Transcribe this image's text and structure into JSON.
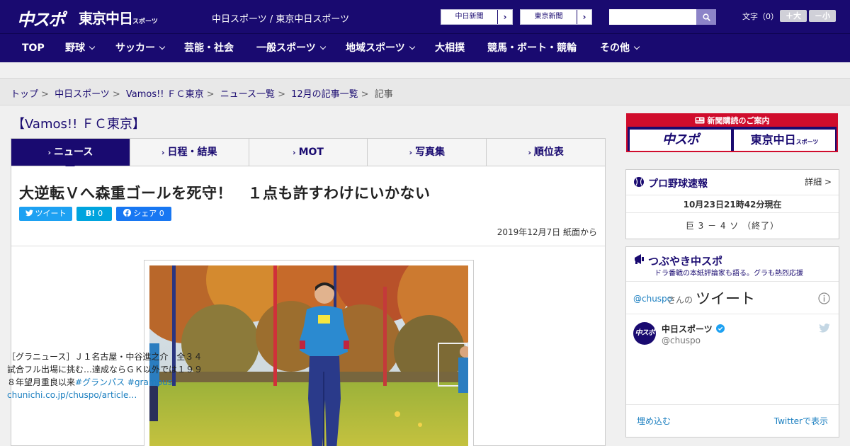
{
  "header": {
    "logo_chuspo": "中スポ",
    "logo_tokyo": "東京中日",
    "logo_tokyo_small": "スポーツ",
    "site_name": "中日スポーツ / 東京中日スポーツ",
    "paper_links": [
      {
        "label": "中日新聞",
        "arrow": "›"
      },
      {
        "label": "東京新聞",
        "arrow": "›"
      }
    ],
    "search_placeholder": "",
    "font_label": "文字（0）",
    "font_larger": "＋大",
    "font_smaller": "－小",
    "colors": {
      "navy": "#190a70",
      "red": "#d00c2c"
    }
  },
  "nav": {
    "items": [
      {
        "label": "TOP",
        "dropdown": false
      },
      {
        "label": "野球",
        "dropdown": true
      },
      {
        "label": "サッカー",
        "dropdown": true
      },
      {
        "label": "芸能・社会",
        "dropdown": false
      },
      {
        "label": "一般スポーツ",
        "dropdown": true
      },
      {
        "label": "地域スポーツ",
        "dropdown": true
      },
      {
        "label": "大相撲",
        "dropdown": false
      },
      {
        "label": "競馬・ボート・競輪",
        "dropdown": false
      },
      {
        "label": "その他",
        "dropdown": true
      }
    ]
  },
  "breadcrumb": {
    "sep": ">",
    "items": [
      "トップ",
      "中日スポーツ",
      "Vamos!! ＦＣ東京",
      "ニュース一覧",
      "12月の記事一覧"
    ],
    "current": "記事"
  },
  "section_title": "【Vamos!! ＦＣ東京】",
  "tabs": [
    {
      "label": "ニュース",
      "active": true
    },
    {
      "label": "日程・結果",
      "active": false
    },
    {
      "label": "MOT",
      "active": false
    },
    {
      "label": "写真集",
      "active": false
    },
    {
      "label": "順位表",
      "active": false
    }
  ],
  "tab_marker": "›",
  "article": {
    "headline": "大逆転Ｖへ森重ゴールを死守！　１点も許すわけにいかない",
    "share": {
      "tweet": "ツイート",
      "hatena": "B!",
      "hatena_count": "0",
      "facebook": "シェア",
      "facebook_count": "0"
    },
    "date": "2019年12月7日 紙面から"
  },
  "sidebar": {
    "subscribe": {
      "title": "新聞購読のご案内",
      "logo_chuspo": "中スポ",
      "logo_tokyo": "東京中日",
      "logo_tokyo_small": "スポーツ"
    },
    "baseball": {
      "title": "プロ野球速報",
      "detail": "詳細 >",
      "time": "10月23日21時42分現在",
      "score": "巨 3 － 4 ソ （終了）"
    },
    "tsubuyaki": {
      "title": "つぶやき中スポ",
      "subtitle": "ドラ番戦の本紙評論家も語る。グラも熱烈応援"
    },
    "twitter": {
      "handle_prefix": "@chuspo",
      "handle_suffix": "さんの",
      "heading": "ツイート",
      "user_name": "中日スポーツ",
      "user_handle": "@chuspo",
      "avatar_text": "中スポ",
      "tweet_text": "［グラニュース］Ｊ１名古屋・中谷進之介　全３４試合フル出場に挑む…達成ならＧＫ以外では１９９８年望月重良以来",
      "tweet_tags": "#グランパス #grampus",
      "tweet_link": "chunichi.co.jp/chuspo/article…",
      "embed": "埋め込む",
      "view_on": "Twitterで表示"
    }
  }
}
